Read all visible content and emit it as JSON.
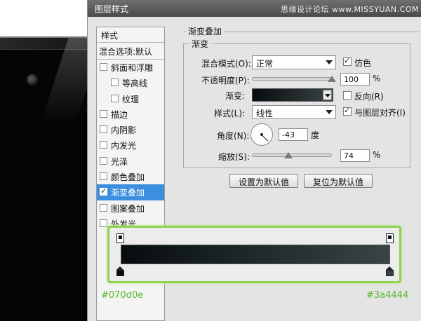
{
  "dialog": {
    "title": "图层样式",
    "watermark": "思缘设计论坛 www.MISSYUAN.COM"
  },
  "styles_panel": {
    "header": "样式",
    "blend_options": "混合选项:默认",
    "items": [
      {
        "label": "斜面和浮雕",
        "checked": false,
        "indent": false,
        "selected": false
      },
      {
        "label": "等高线",
        "checked": false,
        "indent": true,
        "selected": false
      },
      {
        "label": "纹理",
        "checked": false,
        "indent": true,
        "selected": false
      },
      {
        "label": "描边",
        "checked": false,
        "indent": false,
        "selected": false
      },
      {
        "label": "内阴影",
        "checked": false,
        "indent": false,
        "selected": false
      },
      {
        "label": "内发光",
        "checked": false,
        "indent": false,
        "selected": false
      },
      {
        "label": "光泽",
        "checked": false,
        "indent": false,
        "selected": false
      },
      {
        "label": "颜色叠加",
        "checked": false,
        "indent": false,
        "selected": false
      },
      {
        "label": "渐变叠加",
        "checked": true,
        "indent": false,
        "selected": true
      },
      {
        "label": "图案叠加",
        "checked": false,
        "indent": false,
        "selected": false
      },
      {
        "label": "外发光",
        "checked": false,
        "indent": false,
        "selected": false
      }
    ]
  },
  "gradient_overlay": {
    "section_title": "渐变叠加",
    "group_title": "渐变",
    "blend_mode_label": "混合模式(O):",
    "blend_mode_value": "正常",
    "dither_label": "仿色",
    "dither_checked": true,
    "opacity_label": "不透明度(P):",
    "opacity_value": "100",
    "opacity_unit": "%",
    "opacity_level": 1.0,
    "gradient_label": "渐变:",
    "reverse_label": "反向(R)",
    "reverse_checked": false,
    "style_label": "样式(L):",
    "style_value": "线性",
    "align_label": "与图层对齐(I)",
    "align_checked": true,
    "angle_label": "角度(N):",
    "angle_value": "-43",
    "angle_unit": "度",
    "scale_label": "缩放(S):",
    "scale_value": "74",
    "scale_unit": "%",
    "scale_level": 0.74,
    "set_default_button": "设置为默认值",
    "reset_default_button": "复位为默认值"
  },
  "gradient_editor": {
    "start_color": "#070d0e",
    "end_color": "#3a4444",
    "start_label": "#070d0e",
    "end_label": "#3a4444",
    "highlight_color": "#8ed24e"
  }
}
